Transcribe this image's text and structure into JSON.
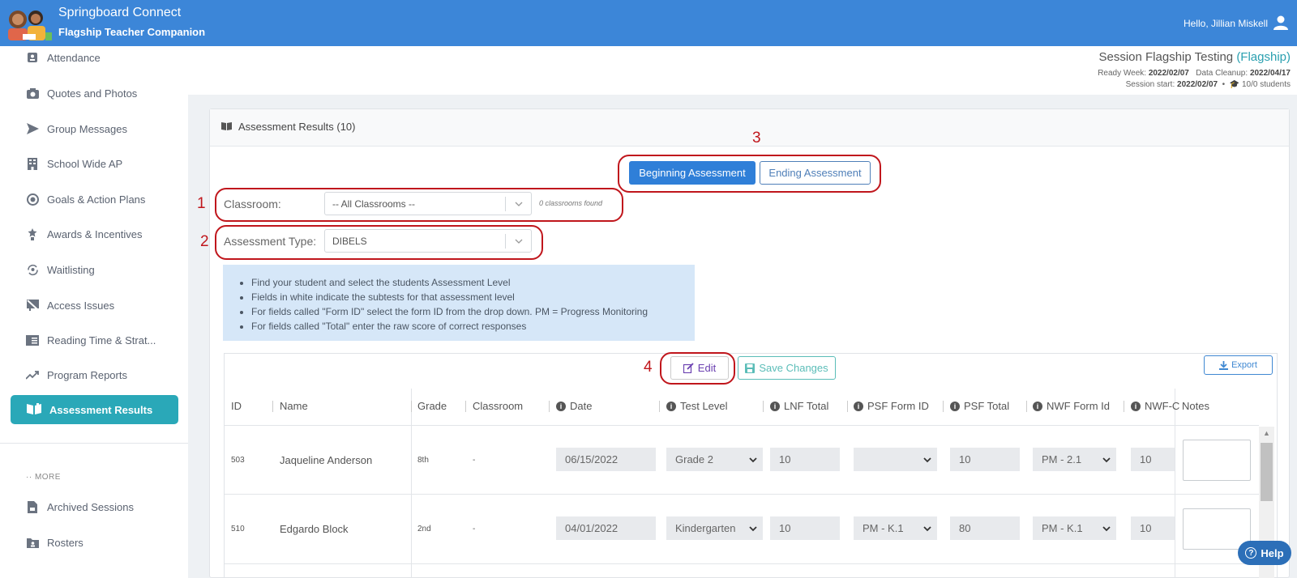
{
  "header": {
    "app_name": "Springboard Connect",
    "app_subtitle": "Flagship Teacher Companion",
    "greeting": "Hello, Jillian Miskell"
  },
  "sidebar": {
    "items": [
      {
        "label": "Attendance",
        "icon": "id-badge-icon"
      },
      {
        "label": "Quotes and Photos",
        "icon": "camera-icon"
      },
      {
        "label": "Group Messages",
        "icon": "send-icon"
      },
      {
        "label": "School Wide AP",
        "icon": "building-icon"
      },
      {
        "label": "Goals & Action Plans",
        "icon": "target-icon"
      },
      {
        "label": "Awards & Incentives",
        "icon": "award-icon"
      },
      {
        "label": "Waitlisting",
        "icon": "refresh-person-icon"
      },
      {
        "label": "Access Issues",
        "icon": "blocked-icon"
      },
      {
        "label": "Reading Time & Strat...",
        "icon": "book-list-icon"
      },
      {
        "label": "Program Reports",
        "icon": "trend-icon"
      }
    ],
    "active_item": {
      "label": "Assessment Results",
      "icon": "open-book-icon"
    },
    "more_label": "·· MORE",
    "more_items": [
      {
        "label": "Archived Sessions",
        "icon": "archive-file-icon"
      },
      {
        "label": "Rosters",
        "icon": "folder-person-icon"
      }
    ]
  },
  "session": {
    "title": "Session Flagship Testing",
    "title_accent": "(Flagship)",
    "ready_week_label": "Ready Week:",
    "ready_week": "2022/02/07",
    "data_cleanup_label": "Data Cleanup:",
    "data_cleanup": "2022/04/17",
    "session_start_label": "Session start:",
    "session_start": "2022/02/07",
    "bullet": "•",
    "students": "10/0 students"
  },
  "panel": {
    "title": "Assessment Results (10)",
    "toggle": {
      "beginning": "Beginning Assessment",
      "ending": "Ending Assessment"
    },
    "classroom_label": "Classroom:",
    "classroom_value": "-- All Classrooms --",
    "classrooms_found": "0 classrooms found",
    "assessment_type_label": "Assessment Type:",
    "assessment_type_value": "DIBELS",
    "instructions": [
      "Find your student and select the students Assessment Level",
      "Fields in white indicate the subtests for that assessment level",
      "For fields called \"Form ID\" select the form ID from the drop down. PM = Progress Monitoring",
      "For fields called \"Total\" enter the raw score of correct responses"
    ]
  },
  "annotations": {
    "one": "1",
    "two": "2",
    "three": "3",
    "four": "4"
  },
  "table": {
    "edit_label": "Edit",
    "save_label": "Save Changes",
    "export_label": "Export",
    "columns": {
      "id": "ID",
      "name": "Name",
      "grade": "Grade",
      "classroom": "Classroom",
      "date": "Date",
      "test_level": "Test Level",
      "lnf_total": "LNF Total",
      "psf_form_id": "PSF Form ID",
      "psf_total": "PSF Total",
      "nwf_form_id": "NWF Form Id",
      "nwf_c": "NWF-C",
      "notes": "Notes"
    },
    "rows": [
      {
        "id": "503",
        "name": "Jaqueline Anderson",
        "grade": "8th",
        "classroom": "-",
        "date": "06/15/2022",
        "test_level": "Grade 2",
        "lnf_total": "10",
        "psf_form_id": "",
        "psf_total": "10",
        "nwf_form_id": "PM - 2.1",
        "nwf_c": "10"
      },
      {
        "id": "510",
        "name": "Edgardo Block",
        "grade": "2nd",
        "classroom": "-",
        "date": "04/01/2022",
        "test_level": "Kindergarten",
        "lnf_total": "10",
        "psf_form_id": "PM - K.1",
        "psf_total": "80",
        "nwf_form_id": "PM - K.1",
        "nwf_c": "10"
      }
    ]
  },
  "help_label": "Help",
  "colors": {
    "header": "#3c86d8",
    "active_nav": "#2aa8b8",
    "annotation": "#c0161c",
    "primary_button": "#2f7fd8"
  }
}
